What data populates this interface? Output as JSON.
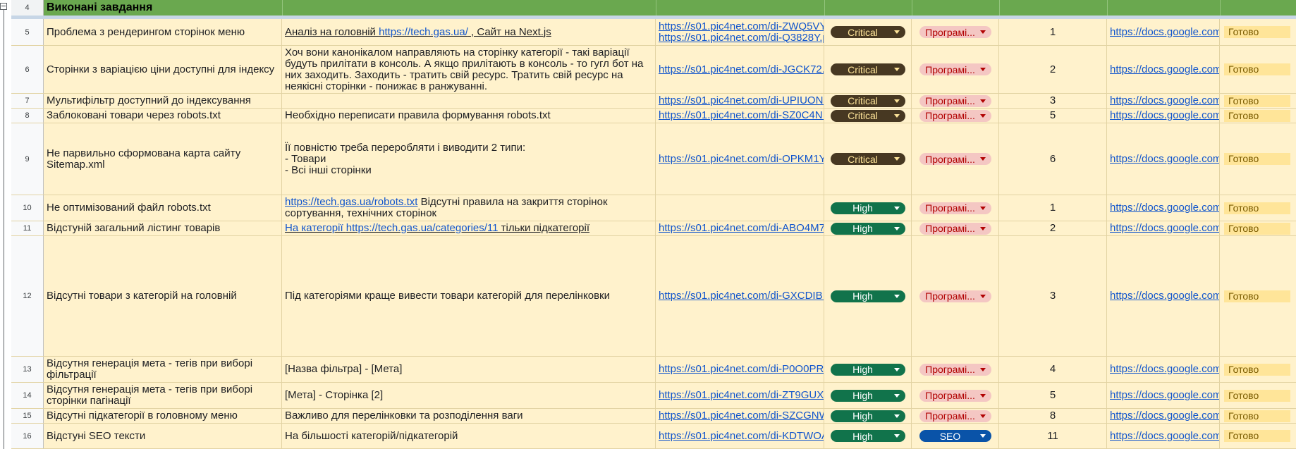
{
  "colors": {
    "row_bg": "#fff2cc",
    "group_header_bg": "#6aa84f",
    "critical_bg": "#473822",
    "high_bg": "#11734b",
    "programmer_bg": "#f4c7c3",
    "seo_bg": "#0a53a8",
    "status_bg": "#ffe599",
    "link": "#1155cc"
  },
  "group": {
    "row_number": "4",
    "title": "Виконані завдання"
  },
  "rows": [
    {
      "num": "5",
      "title": "Проблема з рендерингом сторінок меню",
      "desc_prefix": "Аналіз на головній ",
      "desc_url": "https://tech.gas.ua/",
      "desc_suffix": " , Сайт на Next.js",
      "link": "https://s01.pic4net.com/di-ZWQ5VY.",
      "link2": "https://s01.pic4net.com/di-Q3828Y.p",
      "priority": "Critical",
      "category": "Програмі...",
      "count": "1",
      "doc": "https://docs.google.com",
      "status": "Готово"
    },
    {
      "num": "6",
      "title": "Сторінки з варіацією ціни доступні для індексу",
      "desc": "Хоч вони канонікалом направляють на сторінку категорії - такі варіації будуть прилітати в консоль. А якщо прилітають в консоль - то гугл бот на них заходить. Заходить - тратить свій ресурс. Тратить свій ресурс на неякісні сторінки - понижає в ранжуванні.",
      "link": "https://s01.pic4net.com/di-JGCK72.p",
      "priority": "Critical",
      "category": "Програмі...",
      "count": "2",
      "doc": "https://docs.google.com",
      "status": "Готово"
    },
    {
      "num": "7",
      "title": "Мультифільтр доступний до індексування",
      "desc": "",
      "link": "https://s01.pic4net.com/di-UPIUON.",
      "priority": "Critical",
      "category": "Програмі...",
      "count": "3",
      "doc": "https://docs.google.com",
      "status": "Готово"
    },
    {
      "num": "8",
      "title": "Заблоковані товари через robots.txt",
      "desc": "Необхідно переписати правила формування robots.txt",
      "link": "https://s01.pic4net.com/di-SZ0C4N.p",
      "priority": "Critical",
      "category": "Програмі...",
      "count": "5",
      "doc": "https://docs.google.com",
      "status": "Готово"
    },
    {
      "num": "9",
      "title": "Не парвильно сформована карта сайту Sitemap.xml",
      "desc": "Її повністю треба переробляти і виводити 2 типи:\n- Товари\n- Всі інші сторінки",
      "link": "https://s01.pic4net.com/di-OPKM1Y.",
      "priority": "Critical",
      "category": "Програмі...",
      "count": "6",
      "doc": "https://docs.google.com",
      "status": "Готово"
    },
    {
      "num": "10",
      "title": "Не оптимізований файл robots.txt",
      "desc_url": "https://tech.gas.ua/robots.txt",
      "desc_suffix": " Відсутні правила на закриття сторінок сортування, технічних сторінок",
      "link": "",
      "priority": "High",
      "category": "Програмі...",
      "count": "1",
      "doc": "https://docs.google.com",
      "status": "Готово"
    },
    {
      "num": "11",
      "title": "Відстуній загальний лістинг товарів",
      "desc_prefix": "На категорії ",
      "desc_url": "https://tech.gas.ua/categories/11",
      "desc_suffix": " тільки підкатегорії",
      "link": "https://s01.pic4net.com/di-ABO4M7.",
      "priority": "High",
      "category": "Програмі...",
      "count": "2",
      "doc": "https://docs.google.com",
      "status": "Готово"
    },
    {
      "num": "12",
      "title": "Відсутні товари з категорій на головній",
      "desc": "Під категоріями краще вивести товари категорій для перелінковки",
      "link": "https://s01.pic4net.com/di-GXCDIB.p",
      "priority": "High",
      "category": "Програмі...",
      "count": "3",
      "doc": "https://docs.google.com",
      "status": "Готово"
    },
    {
      "num": "13",
      "title": "Відсутня генерація мета - тегів при виборі фільтрації",
      "desc": "[Назва фільтра] - [Мета]",
      "link": "https://s01.pic4net.com/di-P0O0PR.",
      "priority": "High",
      "category": "Програмі...",
      "count": "4",
      "doc": "https://docs.google.com",
      "status": "Готово"
    },
    {
      "num": "14",
      "title": "Відсутня генерація мета - тегів при виборі сторінки пагінації",
      "desc": "[Мета] - Сторінка [2]",
      "link": "https://s01.pic4net.com/di-ZT9GUX.p",
      "priority": "High",
      "category": "Програмі...",
      "count": "5",
      "doc": "https://docs.google.com",
      "status": "Готово"
    },
    {
      "num": "15",
      "title": "Відсутні підкатегорії в головному меню",
      "desc": "Важливо для перелінковки та розподілення ваги",
      "link": "https://s01.pic4net.com/di-SZCGNW.",
      "priority": "High",
      "category": "Програмі...",
      "count": "8",
      "doc": "https://docs.google.com",
      "status": "Готово"
    },
    {
      "num": "16",
      "title": "Відстуні SEO тексти",
      "desc": "На більшості категорій/підкатегорій",
      "link": "https://s01.pic4net.com/di-KDTWOA",
      "priority": "High",
      "category": "SEO",
      "count": "11",
      "doc": "https://docs.google.com",
      "status": "Готово"
    }
  ]
}
